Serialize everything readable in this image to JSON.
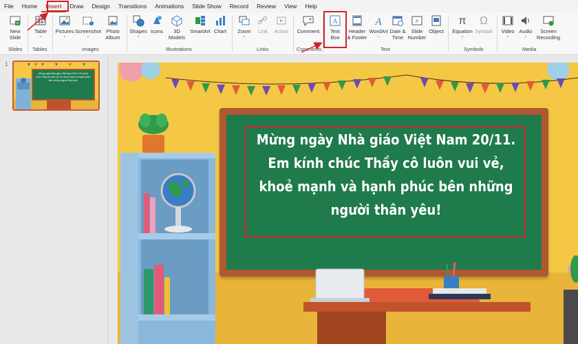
{
  "menu": {
    "items": [
      "File",
      "Home",
      "Insert",
      "Draw",
      "Design",
      "Transitions",
      "Animations",
      "Slide Show",
      "Record",
      "Review",
      "View",
      "Help"
    ],
    "active": "Insert"
  },
  "ribbon": {
    "new_slide": "New Slide",
    "table": "Table",
    "pictures": "Pictures",
    "screenshot": "Screenshot",
    "photo_album": "Photo Album",
    "shapes": "Shapes",
    "icons": "Icons",
    "models_3d": "3D Models",
    "smartart": "SmartArt",
    "chart": "Chart",
    "zoom": "Zoom",
    "link": "Link",
    "action": "Action",
    "comment": "Comment",
    "text_box": "Text Box",
    "header_footer": "Header & Footer",
    "wordart": "WordArt",
    "date_time": "Date & Time",
    "slide_number": "Slide Number",
    "object": "Object",
    "equation": "Equation",
    "symbol": "Symbol",
    "video": "Video",
    "audio": "Audio",
    "screen_recording": "Screen Recording",
    "groups": {
      "slides": "Slides",
      "tables": "Tables",
      "images": "Images",
      "illustrations": "Illustrations",
      "links": "Links",
      "comments": "Comments",
      "text": "Text",
      "symbols": "Symbols",
      "media": "Media"
    }
  },
  "thumbnail": {
    "number": "1",
    "text": "Mừng ngày Nhà giáo Việt Nam 20/11. Em kính chúc Thầy cô luôn vui vẻ, khoẻ mạnh và hạnh phúc bên những người thân yêu!"
  },
  "slide": {
    "lines": [
      "Mừng ngày Nhà giáo Việt Nam 20/11.",
      "Em kính chúc Thầy cô luôn vui vẻ,",
      "khoẻ mạnh và hạnh phúc bên những",
      "người thân yêu!"
    ]
  },
  "colors": {
    "accent": "#b7472a",
    "highlight": "#d4202a",
    "chalkboard": "#1f7a4c",
    "frame": "#b0582f",
    "wall": "#f4c845"
  }
}
